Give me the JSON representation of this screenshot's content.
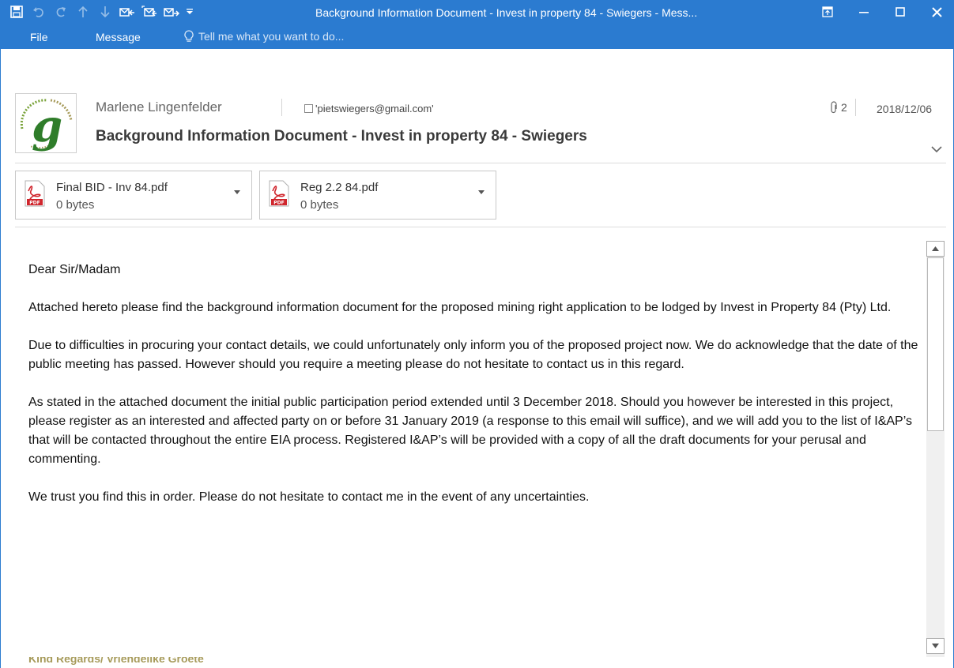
{
  "window": {
    "title": "Background Information Document - Invest in property 84 - Swiegers - Mess..."
  },
  "ribbon": {
    "tabs": [
      "File",
      "Message"
    ],
    "tell_me": "Tell me what you want to do..."
  },
  "header": {
    "sender": "Marlene Lingenfelder",
    "recipient": "'pietswiegers@gmail.com'",
    "attachment_count": "2",
    "date": "2018/12/06",
    "subject": "Background Information Document - Invest in property 84 - Swiegers"
  },
  "attachments": [
    {
      "name": "Final BID - Inv 84.pdf",
      "size": "0 bytes",
      "icon": "pdf-icon"
    },
    {
      "name": "Reg 2.2 84.pdf",
      "size": "0 bytes",
      "icon": "pdf-icon"
    }
  ],
  "body": {
    "greeting": "Dear Sir/Madam",
    "paragraphs": [
      "Attached hereto please find the background information document for the proposed mining right application to be lodged by Invest in Property 84 (Pty) Ltd.",
      "Due to difficulties in procuring your contact details, we could unfortunately only inform you of the proposed project now.  We do acknowledge that the date of the public meeting has passed.  However should you require a meeting please do not hesitate to contact us in this regard.",
      "As stated in the attached document the initial public participation period extended until 3 December 2018.  Should you however be interested in this project, please register as an interested and affected party on or before 31 January 2019 (a response to this email will suffice), and we will add you to the list of I&AP’s that will be contacted throughout the entire EIA process.  Registered I&AP’s will be provided with a copy of all the draft documents for your perusal and commenting.",
      "We trust you find this in order.  Please do not hesitate to contact me in the event of any uncertainties."
    ],
    "signature": "Kind Regards/ Vriendelike Groete"
  },
  "colors": {
    "titlebar": "#2b7bd0",
    "signature": "#a79b5b"
  }
}
